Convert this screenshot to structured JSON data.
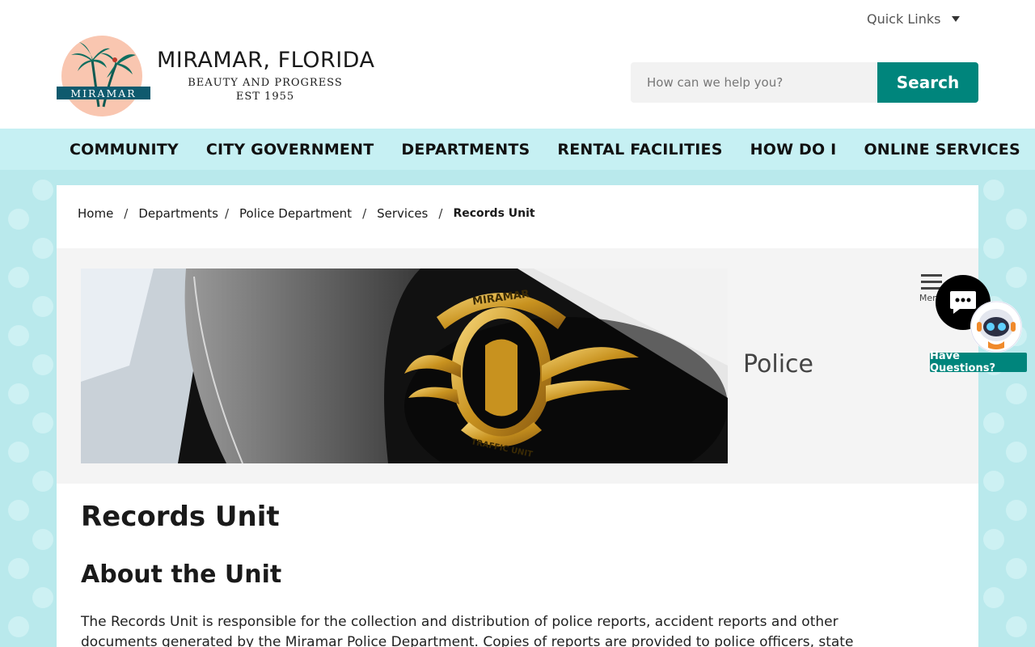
{
  "header": {
    "quick_links": "Quick Links",
    "logo_text": "MIRAMAR",
    "brand_title": "MIRAMAR, FLORIDA",
    "tagline_1": "BEAUTY AND PROGRESS",
    "tagline_2": "EST 1955",
    "search_placeholder": "How can we help you?",
    "search_button": "Search"
  },
  "nav": {
    "items": [
      "COMMUNITY",
      "CITY GOVERNMENT",
      "DEPARTMENTS",
      "RENTAL FACILITIES",
      "HOW DO I",
      "ONLINE SERVICES"
    ]
  },
  "breadcrumb": {
    "items": [
      "Home",
      "Departments",
      "Police Department",
      "Services"
    ],
    "separator": "/",
    "current": "Records Unit"
  },
  "banner": {
    "title": "Police",
    "badge_top_text": "MIRAMAR",
    "badge_bottom_text": "TRAFFIC UNIT"
  },
  "menu": {
    "label": "Menu"
  },
  "content": {
    "page_title": "Records Unit",
    "section_title": "About the Unit",
    "paragraph": "The Records Unit is responsible for the collection and distribution of police reports, accident reports and other documents generated by the Miramar Police Department. Copies of reports are provided to police officers, state"
  },
  "chat": {
    "have_questions": "Have Questions?"
  },
  "colors": {
    "accent": "#00857c",
    "nav_bg": "#c6f0f3",
    "page_bg": "#b9e9ec"
  }
}
